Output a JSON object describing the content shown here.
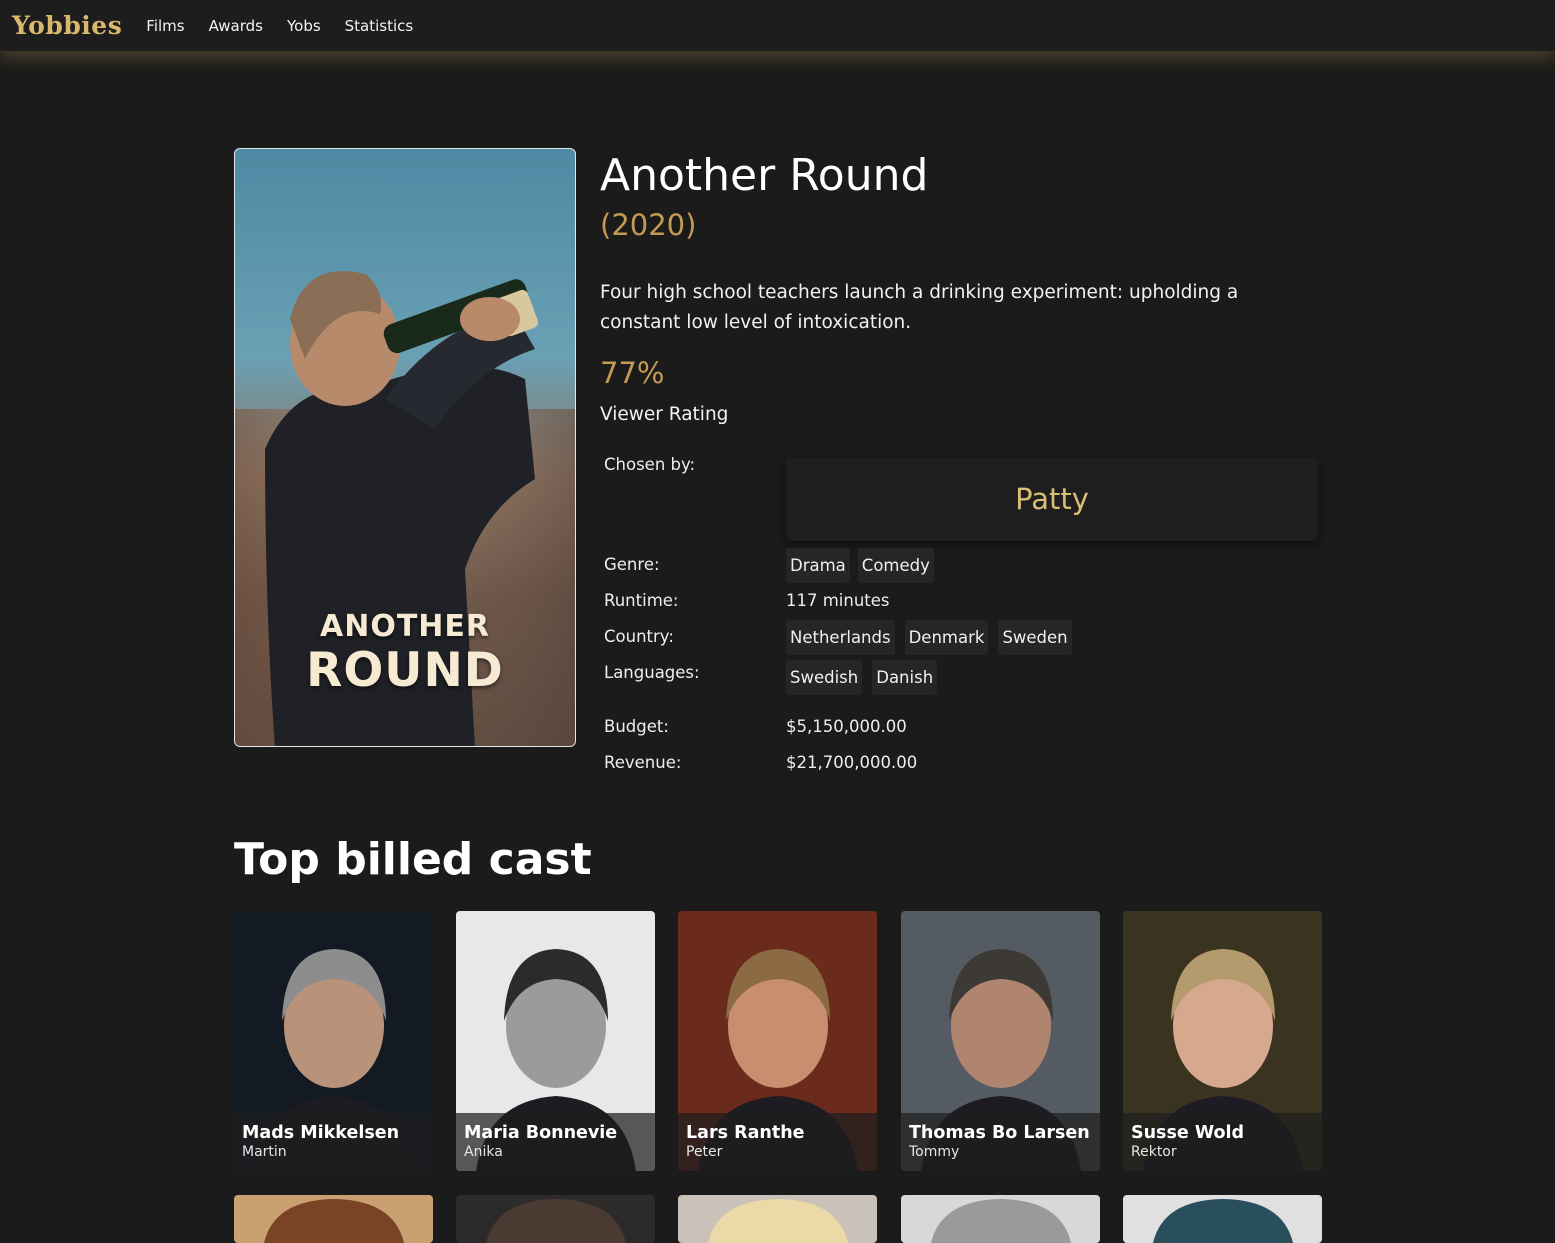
{
  "nav": {
    "brand": "Yobbies",
    "links": [
      "Films",
      "Awards",
      "Yobs",
      "Statistics"
    ]
  },
  "film": {
    "title": "Another Round",
    "year": "(2020)",
    "overview": "Four high school teachers launch a drinking experiment: upholding a constant low level of intoxication.",
    "rating": "77%",
    "rating_label": "Viewer Rating",
    "poster": {
      "line1": "ANOTHER",
      "line2": "ROUND"
    }
  },
  "details": {
    "chosen_label": "Chosen by:",
    "chosen_by": "Patty",
    "genre_label": "Genre:",
    "genres": [
      "Drama",
      "Comedy"
    ],
    "runtime_label": "Runtime:",
    "runtime": "117 minutes",
    "country_label": "Country:",
    "countries": [
      "Netherlands",
      "Denmark",
      "Sweden"
    ],
    "languages_label": "Languages:",
    "languages": [
      "Swedish",
      "Danish"
    ],
    "budget_label": "Budget:",
    "budget": "$5,150,000.00",
    "revenue_label": "Revenue:",
    "revenue": "$21,700,000.00"
  },
  "cast": {
    "heading": "Top billed cast",
    "members": [
      {
        "name": "Mads Mikkelsen",
        "role": "Martin",
        "bg": "#141a24",
        "skin": "#b99379",
        "hair": "#8d8d8d"
      },
      {
        "name": "Maria Bonnevie",
        "role": "Anika",
        "bg": "#e8e8e8",
        "skin": "#9b9b9b",
        "hair": "#2b2b2b"
      },
      {
        "name": "Lars Ranthe",
        "role": "Peter",
        "bg": "#6a2a1c",
        "skin": "#c78e70",
        "hair": "#8c6a44"
      },
      {
        "name": "Thomas Bo Larsen",
        "role": "Tommy",
        "bg": "#555b63",
        "skin": "#b08570",
        "hair": "#3d3a36"
      },
      {
        "name": "Susse Wold",
        "role": "Rektor",
        "bg": "#3a3320",
        "skin": "#d6a98f",
        "hair": "#b59a6e"
      }
    ],
    "row2": [
      {
        "bg": "#c9a070",
        "hair": "#7a4326"
      },
      {
        "bg": "#2d2a2a",
        "hair": "#4a3a32"
      },
      {
        "bg": "#c8c2b8",
        "hair": "#ecd9a8"
      },
      {
        "bg": "#d8d8d8",
        "hair": "#9a9a9a"
      },
      {
        "bg": "#e0e0e0",
        "hair": "#2a4f5c"
      }
    ]
  }
}
